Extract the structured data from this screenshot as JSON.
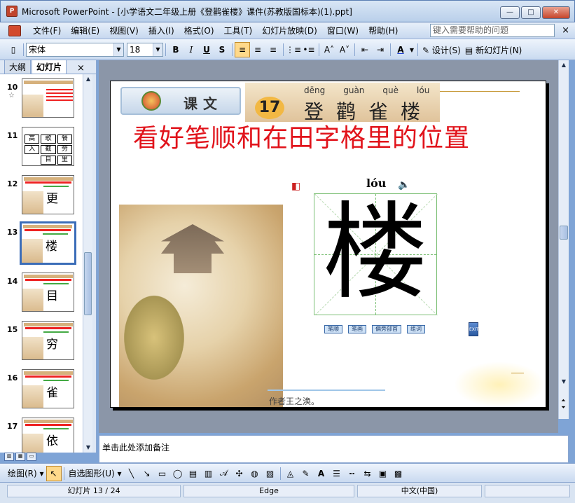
{
  "window": {
    "title": "Microsoft PowerPoint - [小学语文二年级上册《登鹳雀楼》课件(苏教版国标本)(1).ppt]",
    "app_icon": "powerpoint-icon",
    "buttons": {
      "minimize": "—",
      "maximize": "□",
      "close": "✕"
    }
  },
  "menubar": {
    "items": [
      "文件(F)",
      "编辑(E)",
      "视图(V)",
      "插入(I)",
      "格式(O)",
      "工具(T)",
      "幻灯片放映(D)",
      "窗口(W)",
      "帮助(H)"
    ],
    "help_placeholder": "键入需要帮助的问题",
    "close": "×"
  },
  "toolbar": {
    "font": "宋体",
    "size": "18",
    "bold": "B",
    "italic": "I",
    "underline": "U",
    "shadow": "S",
    "align_left": "≡",
    "align_center": "≡",
    "align_right": "≡",
    "numbering": "⋮≡",
    "bullets": "•≡",
    "grow_font": "A˄",
    "shrink_font": "A˅",
    "decrease_indent": "⇤",
    "increase_indent": "⇥",
    "font_color": "A",
    "design": "设计(S)",
    "new_slide": "新幻灯片(N)",
    "accent_color": "#ffd98a"
  },
  "leftpane": {
    "tabs": [
      "大纲",
      "幻灯片"
    ],
    "close": "×",
    "thumbs": [
      {
        "num": "10",
        "star": "☆",
        "char": "",
        "grid": []
      },
      {
        "num": "11",
        "star": "",
        "char": "",
        "grid": [
          "高",
          "歌",
          "餐",
          "入",
          "截",
          "劳",
          "",
          "目",
          "里"
        ]
      },
      {
        "num": "12",
        "star": "",
        "char": "更",
        "grid": []
      },
      {
        "num": "13",
        "star": "",
        "char": "楼",
        "grid": []
      },
      {
        "num": "14",
        "star": "",
        "char": "目",
        "grid": []
      },
      {
        "num": "15",
        "star": "",
        "char": "穷",
        "grid": []
      },
      {
        "num": "16",
        "star": "",
        "char": "雀",
        "grid": []
      },
      {
        "num": "17",
        "star": "",
        "char": "依",
        "grid": []
      }
    ]
  },
  "slide": {
    "kewen_label": "课文",
    "lesson_number": "17",
    "title_pinyin": [
      "dēng",
      "guàn",
      "què",
      "lóu"
    ],
    "title_hanzi": [
      "登",
      "鹳",
      "雀",
      "楼"
    ],
    "main_title": "看好笔顺和在田字格里的位置",
    "char_pinyin": "lóu",
    "big_char": "楼",
    "controls": [
      "笔顺",
      "笔画",
      "偏旁部首",
      "组词"
    ],
    "exit_label": "EXIT",
    "author": "作者王之涣。",
    "title_color": "#e1131b"
  },
  "notes": {
    "placeholder": "单击此处添加备注"
  },
  "drawbar": {
    "draw": "绘图(R)",
    "autoshapes": "自选图形(U)"
  },
  "statusbar": {
    "slide_info": "幻灯片 13 / 24",
    "template": "Edge",
    "language": "中文(中国)"
  }
}
